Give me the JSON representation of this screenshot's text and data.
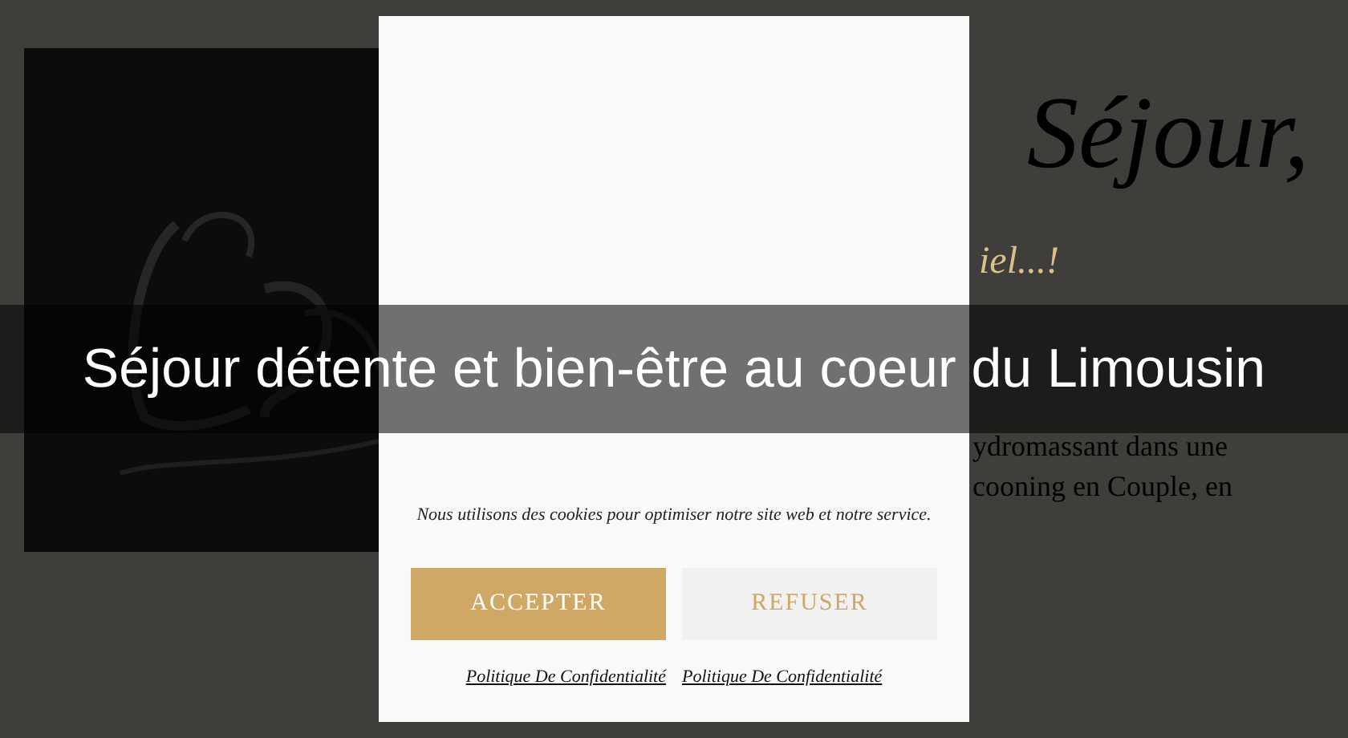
{
  "page": {
    "heading": "Séjour,",
    "subheading": "iel...!",
    "paragraph_lines": [
      "ydromassant dans une",
      "cooning en Couple, en"
    ]
  },
  "cookie_dialog": {
    "message": "Nous utilisons des cookies pour optimiser notre site web et notre service.",
    "buttons": [
      {
        "label": "ACCEPTER",
        "kind": "primary"
      },
      {
        "label": "REFUSER",
        "kind": "secondary"
      }
    ],
    "links": [
      "Politique De Confidentialité",
      "Politique De Confidentialité"
    ]
  },
  "banner": {
    "title": "Séjour détente et bien-être au coeur du Limousin"
  }
}
